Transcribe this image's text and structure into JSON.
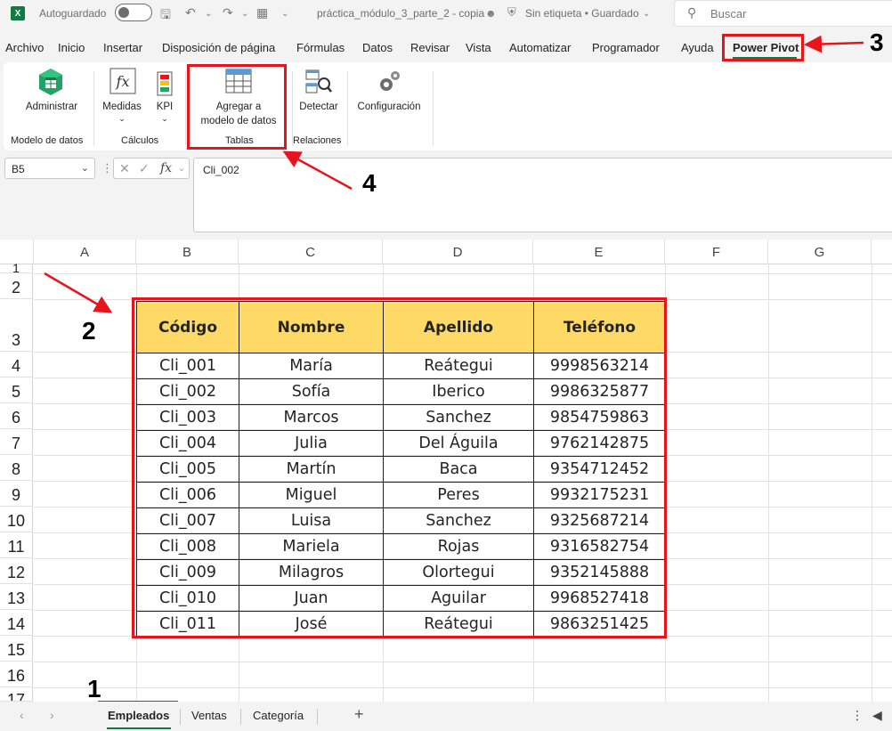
{
  "titlebar": {
    "autosave_label": "Autoguardado",
    "document_title": "práctica_módulo_3_parte_2 - copia",
    "label_status": "Sin etiqueta • Guardado",
    "search_placeholder": "Buscar",
    "app_logo": "X"
  },
  "menu": {
    "items": [
      "Archivo",
      "Inicio",
      "Insertar",
      "Disposición de página",
      "Fórmulas",
      "Datos",
      "Revisar",
      "Vista",
      "Automatizar",
      "Programador",
      "Ayuda",
      "Power Pivot"
    ],
    "active": "Power Pivot"
  },
  "ribbon": {
    "administrar": "Administrar",
    "medidas": "Medidas",
    "kpi": "KPI",
    "agregar_line1": "Agregar a",
    "agregar_line2": "modelo de datos",
    "detectar": "Detectar",
    "configuracion": "Configuración",
    "groups": {
      "modelo": "Modelo de datos",
      "calculos": "Cálculos",
      "tablas": "Tablas",
      "relaciones": "Relaciones"
    }
  },
  "formula_bar": {
    "name_box": "B5",
    "formula": "Cli_002"
  },
  "grid": {
    "columns": [
      "A",
      "B",
      "C",
      "D",
      "E",
      "F",
      "G"
    ],
    "rows": [
      "1",
      "2",
      "3",
      "4",
      "5",
      "6",
      "7",
      "8",
      "9",
      "10",
      "11",
      "12",
      "13",
      "14",
      "15",
      "16",
      "17"
    ]
  },
  "table": {
    "headers": [
      "Código",
      "Nombre",
      "Apellido",
      "Teléfono"
    ],
    "rows": [
      [
        "Cli_001",
        "María",
        "Reátegui",
        "9998563214"
      ],
      [
        "Cli_002",
        "Sofía",
        "Iberico",
        "9986325877"
      ],
      [
        "Cli_003",
        "Marcos",
        "Sanchez",
        "9854759863"
      ],
      [
        "Cli_004",
        "Julia",
        "Del Águila",
        "9762142875"
      ],
      [
        "Cli_005",
        "Martín",
        "Baca",
        "9354712452"
      ],
      [
        "Cli_006",
        "Miguel",
        "Peres",
        "9932175231"
      ],
      [
        "Cli_007",
        "Luisa",
        "Sanchez",
        "9325687214"
      ],
      [
        "Cli_008",
        "Mariela",
        "Rojas",
        "9316582754"
      ],
      [
        "Cli_009",
        "Milagros",
        "Olortegui",
        "9352145888"
      ],
      [
        "Cli_010",
        "Juan",
        "Aguilar",
        "9968527418"
      ],
      [
        "Cli_011",
        "José",
        "Reátegui",
        "9863251425"
      ]
    ],
    "header_fill": "#ffd966"
  },
  "annotations": {
    "step1": "1",
    "step2": "2",
    "step3": "3",
    "step4": "4",
    "color": "#e8141c"
  },
  "sheet_tabs": {
    "tabs": [
      "Empleados",
      "Ventas",
      "Categoría"
    ],
    "active": "Empleados",
    "add_label": "+"
  },
  "colors": {
    "excel_green": "#107c41"
  }
}
